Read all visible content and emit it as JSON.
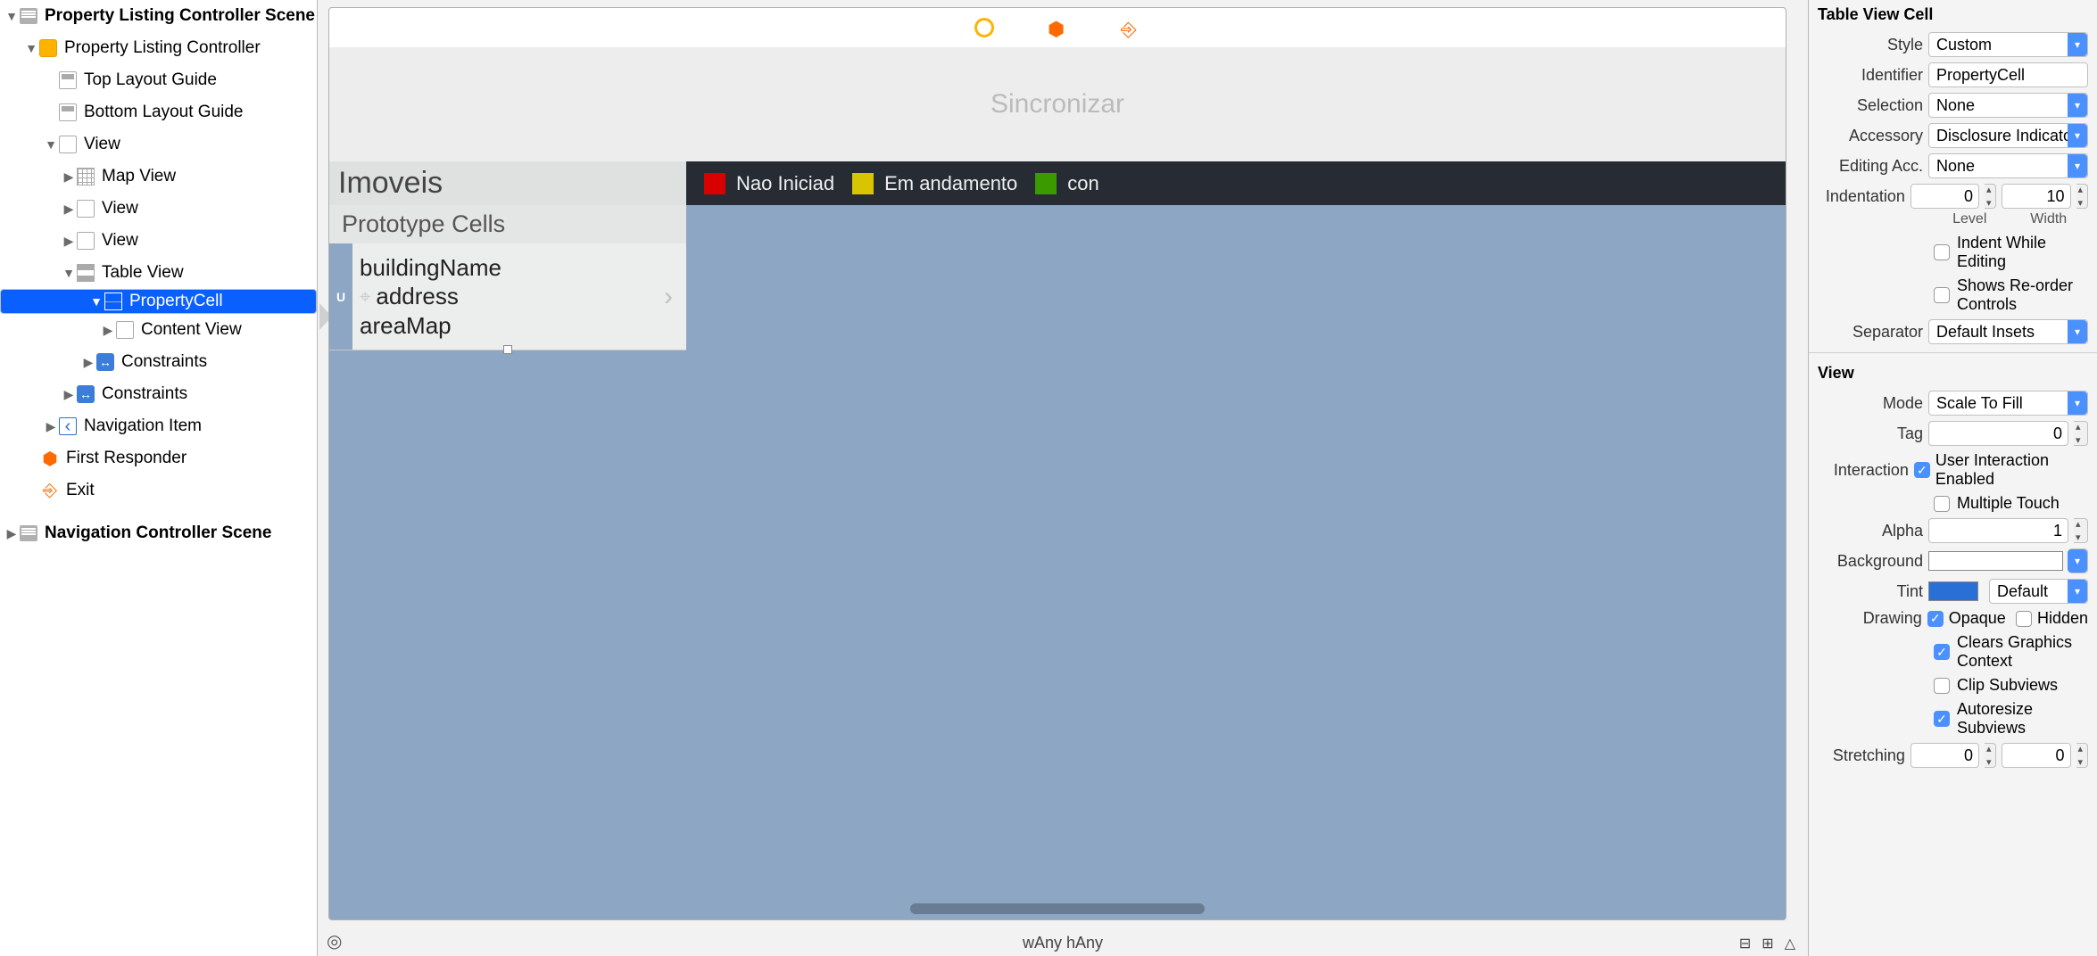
{
  "outline": {
    "scene1": "Property Listing Controller Scene",
    "vc": "Property Listing Controller",
    "topGuide": "Top Layout Guide",
    "bottomGuide": "Bottom Layout Guide",
    "view": "View",
    "mapView": "Map View",
    "view2": "View",
    "view3": "View",
    "tableView": "Table View",
    "propertyCell": "PropertyCell",
    "contentView": "Content View",
    "constraints": "Constraints",
    "constraints2": "Constraints",
    "navItem": "Navigation Item",
    "firstResponder": "First Responder",
    "exit": "Exit",
    "scene2": "Navigation Controller Scene"
  },
  "canvas": {
    "sync": "Sincronizar",
    "imoveis": "Imoveis",
    "leg1": "Nao Iniciad",
    "leg2": "Em andamento",
    "leg3": "con",
    "proto": "Prototype Cells",
    "building": "buildingName",
    "address": "address",
    "areaMap": "areaMap",
    "uLetter": "U",
    "wAny": "wAny",
    "hAny": "hAny"
  },
  "inspector": {
    "tvc": "Table View Cell",
    "styleLbl": "Style",
    "style": "Custom",
    "identifierLbl": "Identifier",
    "identifier": "PropertyCell",
    "selectionLbl": "Selection",
    "selection": "None",
    "accessoryLbl": "Accessory",
    "accessory": "Disclosure Indicator",
    "editingAccLbl": "Editing Acc.",
    "editingAcc": "None",
    "indentationLbl": "Indentation",
    "indentLevel": "0",
    "indentWidth": "10",
    "levelLbl": "Level",
    "widthLbl": "Width",
    "indentWhile": "Indent While Editing",
    "showsReorder": "Shows Re-order Controls",
    "separatorLbl": "Separator",
    "separator": "Default Insets",
    "viewHead": "View",
    "modeLbl": "Mode",
    "mode": "Scale To Fill",
    "tagLbl": "Tag",
    "tag": "0",
    "interactionLbl": "Interaction",
    "userInteraction": "User Interaction Enabled",
    "multipleTouch": "Multiple Touch",
    "alphaLbl": "Alpha",
    "alpha": "1",
    "backgroundLbl": "Background",
    "tintLbl": "Tint",
    "tint": "Default",
    "drawingLbl": "Drawing",
    "opaque": "Opaque",
    "hidden": "Hidden",
    "clearsGraphics": "Clears Graphics Context",
    "clipSubviews": "Clip Subviews",
    "autoresize": "Autoresize Subviews",
    "stretchingLbl": "Stretching",
    "stretch0a": "0",
    "stretch0b": "0"
  }
}
